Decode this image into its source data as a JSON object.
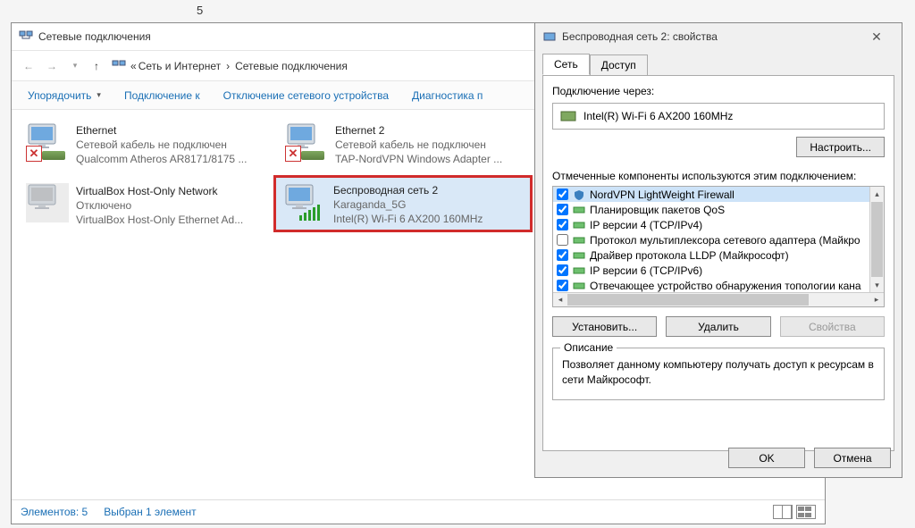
{
  "topnum": "5",
  "explorer": {
    "title": "Сетевые подключения",
    "breadcrumb": {
      "sep": "«",
      "a": "Сеть и Интернет",
      "b": "Сетевые подключения"
    },
    "toolbar": {
      "organize": "Упорядочить",
      "connect_to": "Подключение к",
      "disable": "Отключение сетевого устройства",
      "diag": "Диагностика п"
    },
    "connections": [
      {
        "name": "Ethernet",
        "status": "Сетевой кабель не подключен",
        "desc": "Qualcomm Atheros AR8171/8175 ..."
      },
      {
        "name": "Ethernet 2",
        "status": "Сетевой кабель не подключен",
        "desc": "TAP-NordVPN Windows Adapter ..."
      },
      {
        "name": "VirtualBox Host-Only Network",
        "status": "Отключено",
        "desc": "VirtualBox Host-Only Ethernet Ad..."
      },
      {
        "name": "Беспроводная сеть 2",
        "status": "Karaganda_5G",
        "desc": "Intel(R) Wi-Fi 6 AX200 160MHz"
      }
    ],
    "status": {
      "count": "Элементов: 5",
      "selected": "Выбран 1 элемент"
    }
  },
  "props": {
    "title": "Беспроводная сеть 2: свойства",
    "tabs": {
      "net": "Сеть",
      "access": "Доступ"
    },
    "conn_via_label": "Подключение через:",
    "conn_via_value": "Intel(R) Wi-Fi 6 AX200 160MHz",
    "configure": "Настроить...",
    "components_label": "Отмеченные компоненты используются этим подключением:",
    "components": [
      {
        "checked": true,
        "label": "NordVPN LightWeight Firewall"
      },
      {
        "checked": true,
        "label": "Планировщик пакетов QoS"
      },
      {
        "checked": true,
        "label": "IP версии 4 (TCP/IPv4)"
      },
      {
        "checked": false,
        "label": "Протокол мультиплексора сетевого адаптера (Майкро"
      },
      {
        "checked": true,
        "label": "Драйвер протокола LLDP (Майкрософт)"
      },
      {
        "checked": true,
        "label": "IP версии 6 (TCP/IPv6)"
      },
      {
        "checked": true,
        "label": "Отвечающее устройство обнаружения топологии кана"
      }
    ],
    "install": "Установить...",
    "uninstall": "Удалить",
    "properties": "Свойства",
    "desc_label": "Описание",
    "desc_text": "Позволяет данному компьютеру получать доступ к ресурсам в сети Майкрософт.",
    "ok": "OK",
    "cancel": "Отмена"
  }
}
